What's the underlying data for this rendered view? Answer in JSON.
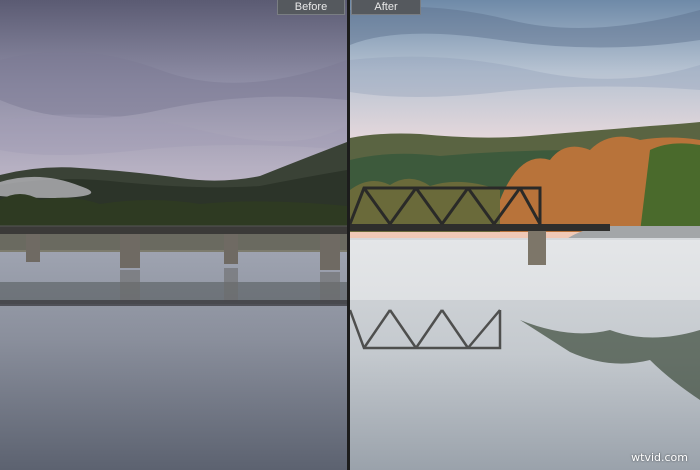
{
  "comparison": {
    "before_label": "Before",
    "after_label": "After",
    "mode": "side-by-side"
  },
  "watermark": {
    "text": "wtvid.com"
  },
  "colors": {
    "tab_background": "#55595e",
    "tab_text": "#e9e9e9",
    "divider": "#1c1c1c"
  }
}
